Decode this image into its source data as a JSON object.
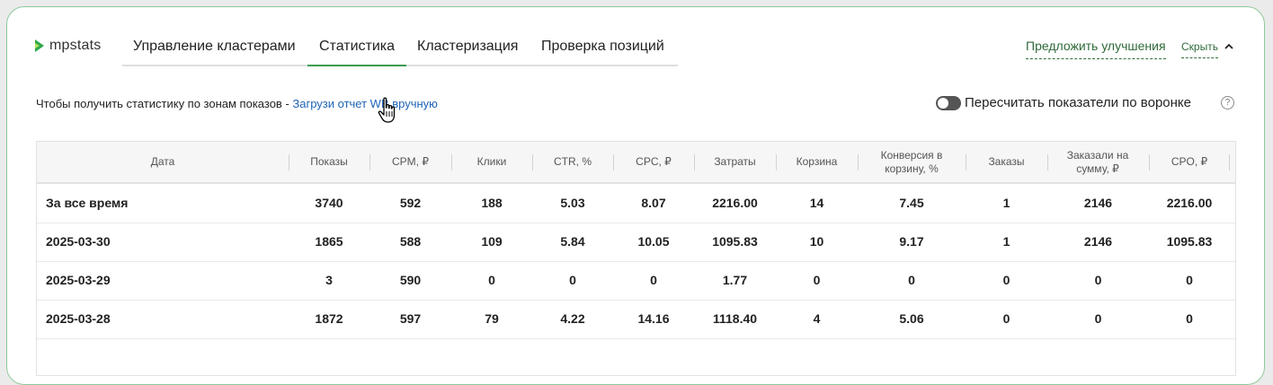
{
  "logo": {
    "text": "mpstats"
  },
  "tabs": [
    {
      "label": "Управление кластерами",
      "active": false
    },
    {
      "label": "Статистика",
      "active": true
    },
    {
      "label": "Кластеризация",
      "active": false
    },
    {
      "label": "Проверка позиций",
      "active": false
    }
  ],
  "header_actions": {
    "suggest": "Предложить улучшения",
    "hide": "Скрыть"
  },
  "info": {
    "text": "Чтобы получить статистику по зонам показов - ",
    "link": "Загрузи отчет WB вручную"
  },
  "toggle": {
    "label": "Пересчитать показатели по воронке",
    "on": false,
    "help": "?"
  },
  "colors": {
    "accent": "#3d9a50",
    "link": "#1e63b5",
    "border": "#8ec99a"
  },
  "table": {
    "headers": [
      "Дата",
      "Показы",
      "CPM, ₽",
      "Клики",
      "CTR, %",
      "CPC, ₽",
      "Затраты",
      "Корзина",
      "Конверсия в корзину, %",
      "Заказы",
      "Заказали на сумму, ₽",
      "CPO, ₽"
    ],
    "rows": [
      [
        "За все время",
        "3740",
        "592",
        "188",
        "5.03",
        "8.07",
        "2216.00",
        "14",
        "7.45",
        "1",
        "2146",
        "2216.00"
      ],
      [
        "2025-03-30",
        "1865",
        "588",
        "109",
        "5.84",
        "10.05",
        "1095.83",
        "10",
        "9.17",
        "1",
        "2146",
        "1095.83"
      ],
      [
        "2025-03-29",
        "3",
        "590",
        "0",
        "0",
        "0",
        "1.77",
        "0",
        "0",
        "0",
        "0",
        "0"
      ],
      [
        "2025-03-28",
        "1872",
        "597",
        "79",
        "4.22",
        "14.16",
        "1118.40",
        "4",
        "5.06",
        "0",
        "0",
        "0"
      ]
    ]
  }
}
